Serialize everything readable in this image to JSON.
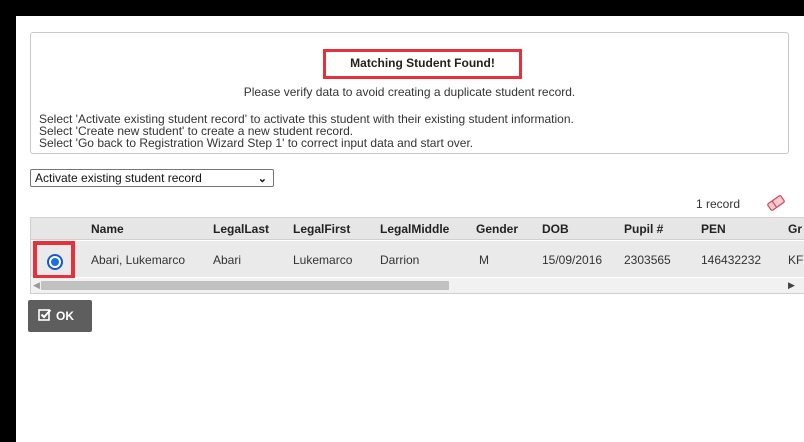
{
  "notice": {
    "title": "Matching Student Found!",
    "subtitle": "Please verify data to avoid creating a duplicate student record.",
    "lines": [
      "Select 'Activate existing student record' to activate this student with their existing student information.",
      "Select 'Create new student' to create a new student record.",
      "Select 'Go back to Registration Wizard Step 1' to correct input data and start over."
    ]
  },
  "action_select": {
    "selected": "Activate existing student record"
  },
  "records": {
    "count_label": "1 record",
    "icon": "eraser-icon"
  },
  "table": {
    "columns": [
      "Name",
      "LegalLast",
      "LegalFirst",
      "LegalMiddle",
      "Gender",
      "DOB",
      "Pupil #",
      "PEN",
      "Gr"
    ],
    "rows": [
      {
        "selected": true,
        "cells": [
          "Abari, Lukemarco",
          "Abari",
          "Lukemarco",
          "Darrion",
          "M",
          "15/09/2016",
          "2303565",
          "146432232",
          "KF"
        ]
      }
    ]
  },
  "ok_button": {
    "label": "OK",
    "icon": "check-square-icon"
  },
  "colors": {
    "highlight_border": "#e8303a",
    "radio_blue": "#1a6fe6",
    "button_bg": "#5e5e5e"
  }
}
